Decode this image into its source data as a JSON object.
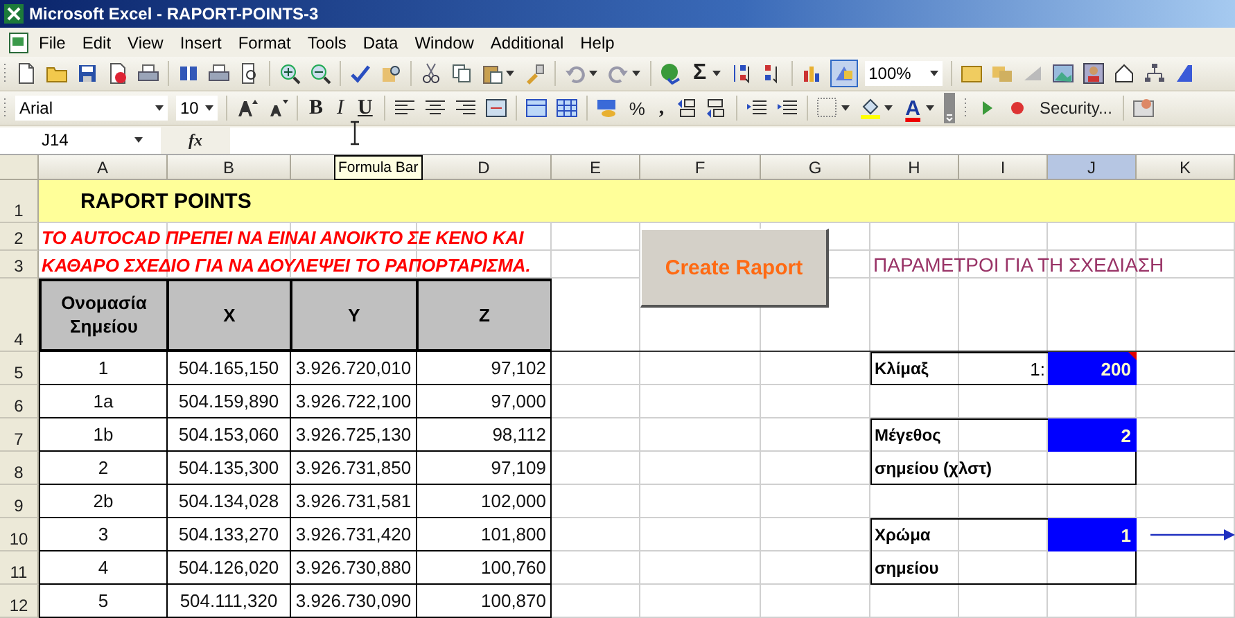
{
  "window": {
    "title": "Microsoft Excel - RAPORT-POINTS-3"
  },
  "menu": [
    "File",
    "Edit",
    "View",
    "Insert",
    "Format",
    "Tools",
    "Data",
    "Window",
    "Additional",
    "Help"
  ],
  "standard_toolbar": {
    "sum": "Σ",
    "zoom": "100%"
  },
  "formatting_toolbar": {
    "font": "Arial",
    "size": "10",
    "bold": "B",
    "italic": "I",
    "underline": "U",
    "percent": "%",
    "comma": ",",
    "font_color": "A",
    "security": "Security..."
  },
  "formula_bar": {
    "name_box": "J14",
    "fx": "fx",
    "tooltip": "Formula Bar"
  },
  "sheet": {
    "columns": [
      {
        "label": "A",
        "selected": false
      },
      {
        "label": "B",
        "selected": false
      },
      {
        "selected": false
      },
      {
        "label": "D",
        "selected": false
      },
      {
        "label": "E",
        "selected": false
      },
      {
        "label": "F",
        "selected": false
      },
      {
        "label": "G",
        "selected": false
      },
      {
        "label": "H",
        "selected": false
      },
      {
        "label": "I",
        "selected": false
      },
      {
        "label": "J",
        "selected": true
      },
      {
        "label": "K",
        "selected": false
      }
    ],
    "rows": [
      "1",
      "2",
      "3",
      "4",
      "5",
      "6",
      "7",
      "8",
      "9",
      "10",
      "11",
      "12"
    ],
    "title": "RAPORT POINTS",
    "notice": [
      "TO AUTOCAD ΠΡΕΠΕΙ ΝΑ ΕΙΝΑΙ ΑΝΟΙΚΤΟ ΣΕ ΚΕΝΟ ΚΑΙ",
      "ΚΑΘΑΡΟ ΣΧΕΔΙΟ ΓΙΑ ΝΑ ΔΟΥΛΕΨΕΙ ΤΟ ΡΑΠΟΡΤΑΡΙΣΜΑ."
    ],
    "points_table": {
      "columns": [
        "Ονομασία Σημείου",
        "X",
        "Y",
        "Z"
      ],
      "rows": [
        [
          "1",
          "504.165,150",
          "3.926.720,010",
          "97,102"
        ],
        [
          "1a",
          "504.159,890",
          "3.926.722,100",
          "97,000"
        ],
        [
          "1b",
          "504.153,060",
          "3.926.725,130",
          "98,112"
        ],
        [
          "2",
          "504.135,300",
          "3.926.731,850",
          "97,109"
        ],
        [
          "2b",
          "504.134,028",
          "3.926.731,581",
          "102,000"
        ],
        [
          "3",
          "504.133,270",
          "3.926.731,420",
          "101,800"
        ],
        [
          "4",
          "504.126,020",
          "3.926.730,880",
          "100,760"
        ],
        [
          "5",
          "504.111,320",
          "3.926.730,090",
          "100,870"
        ]
      ]
    },
    "create_button": "Create Raport",
    "parameters": {
      "title": "ΠΑΡΑΜΕΤΡΟΙ ΓΙΑ ΤΗ ΣΧΕΔΙΑΣΗ",
      "scale": {
        "label": "Κλίμαξ",
        "prefix": "1:",
        "value": "200",
        "has_comment": true
      },
      "size": {
        "label": "Μέγεθος",
        "label_2": "σημείου (χλστ)",
        "value": "2"
      },
      "color": {
        "label": "Χρώμα",
        "label_2": "σημείου",
        "value": "1"
      }
    }
  }
}
